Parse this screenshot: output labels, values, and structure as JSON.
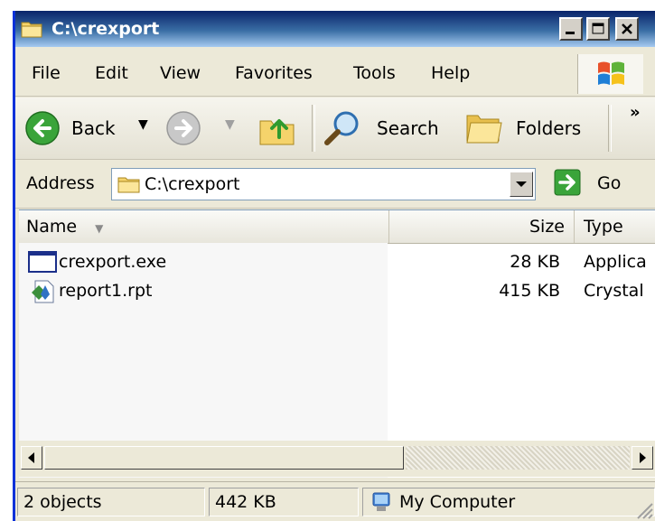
{
  "window": {
    "title": "C:\\crexport",
    "icon": "folder-icon"
  },
  "menu": {
    "items": [
      "File",
      "Edit",
      "View",
      "Favorites",
      "Tools",
      "Help"
    ]
  },
  "toolbar": {
    "back_label": "Back",
    "search_label": "Search",
    "folders_label": "Folders",
    "overflow": "»"
  },
  "address": {
    "label": "Address",
    "value": "C:\\crexport",
    "go_label": "Go"
  },
  "list": {
    "columns": [
      "Name",
      "Size",
      "Type"
    ],
    "rows": [
      {
        "name": "crexport.exe",
        "size": "28 KB",
        "type": "Applica",
        "icon": "application-icon"
      },
      {
        "name": "report1.rpt",
        "size": "415 KB",
        "type": "Crystal",
        "icon": "crystal-report-icon"
      }
    ]
  },
  "status": {
    "objects": "2 objects",
    "size": "442 KB",
    "location": "My Computer"
  },
  "colors": {
    "title_bar": "#0a246a",
    "window_face": "#ece9d8",
    "border": "#0831d9"
  }
}
